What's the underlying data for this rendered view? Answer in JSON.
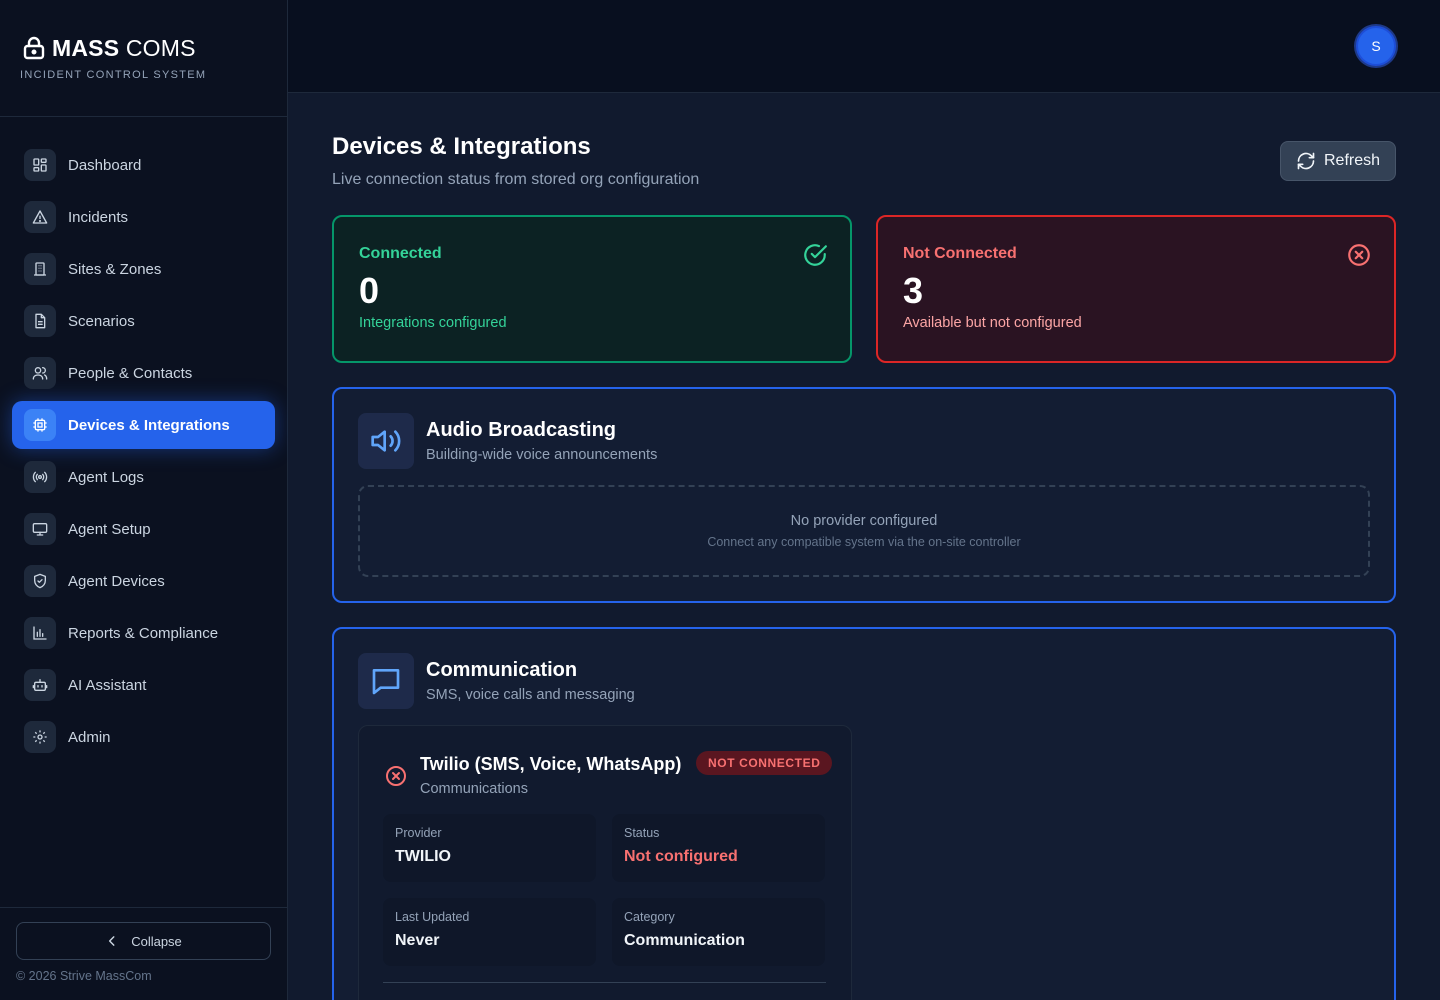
{
  "brand": {
    "name_bold": "MASS",
    "name_light": "COMS",
    "tagline": "INCIDENT CONTROL SYSTEM"
  },
  "nav": [
    {
      "label": "Dashboard",
      "icon": "grid-icon"
    },
    {
      "label": "Incidents",
      "icon": "warning-icon"
    },
    {
      "label": "Sites & Zones",
      "icon": "building-icon"
    },
    {
      "label": "Scenarios",
      "icon": "document-icon"
    },
    {
      "label": "People & Contacts",
      "icon": "users-icon"
    },
    {
      "label": "Devices & Integrations",
      "icon": "chip-icon",
      "active": true
    },
    {
      "label": "Agent Logs",
      "icon": "broadcast-icon"
    },
    {
      "label": "Agent Setup",
      "icon": "monitor-icon"
    },
    {
      "label": "Agent Devices",
      "icon": "shield-icon"
    },
    {
      "label": "Reports & Compliance",
      "icon": "bar-chart-icon"
    },
    {
      "label": "AI Assistant",
      "icon": "robot-icon"
    },
    {
      "label": "Admin",
      "icon": "gear-icon"
    }
  ],
  "sidebar_footer": {
    "collapse_label": "Collapse",
    "copyright": "© 2026 Strive MassCom"
  },
  "user": {
    "initial": "S"
  },
  "page": {
    "title": "Devices & Integrations",
    "subtitle": "Live connection status from stored org configuration",
    "refresh_label": "Refresh"
  },
  "stats": {
    "connected": {
      "title": "Connected",
      "value": "0",
      "desc": "Integrations configured",
      "color": "#34d399"
    },
    "not_connected": {
      "title": "Not Connected",
      "value": "3",
      "desc": "Available but not configured",
      "color": "#f87171"
    }
  },
  "sections": {
    "audio": {
      "title": "Audio Broadcasting",
      "subtitle": "Building-wide voice announcements",
      "empty_title": "No provider configured",
      "empty_sub": "Connect any compatible system via the on-site controller"
    },
    "communication": {
      "title": "Communication",
      "subtitle": "SMS, voice calls and messaging",
      "card": {
        "title": "Twilio (SMS, Voice, WhatsApp)",
        "subtitle": "Communications",
        "badge": "NOT CONNECTED",
        "fields": [
          {
            "label": "Provider",
            "value": "TWILIO"
          },
          {
            "label": "Status",
            "value": "Not configured"
          },
          {
            "label": "Last Updated",
            "value": "Never"
          },
          {
            "label": "Category",
            "value": "Communication"
          }
        ]
      }
    }
  },
  "colors": {
    "accent": "#2563eb",
    "success": "#34d399",
    "danger": "#f87171"
  }
}
